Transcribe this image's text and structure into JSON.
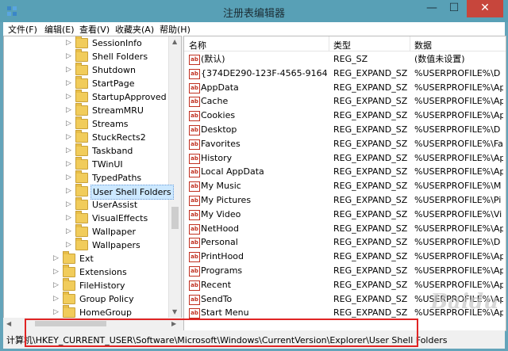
{
  "window": {
    "title": "注册表编辑器",
    "minimize": "—",
    "maximize": "☐",
    "close": "✕"
  },
  "menu": [
    "文件(F)",
    "编辑(E)",
    "查看(V)",
    "收藏夹(A)",
    "帮助(H)"
  ],
  "tree": [
    {
      "label": "SessionInfo",
      "level": 2
    },
    {
      "label": "Shell Folders",
      "level": 2
    },
    {
      "label": "Shutdown",
      "level": 2
    },
    {
      "label": "StartPage",
      "level": 2
    },
    {
      "label": "StartupApproved",
      "level": 2
    },
    {
      "label": "StreamMRU",
      "level": 2
    },
    {
      "label": "Streams",
      "level": 2
    },
    {
      "label": "StuckRects2",
      "level": 2
    },
    {
      "label": "Taskband",
      "level": 2
    },
    {
      "label": "TWinUI",
      "level": 2
    },
    {
      "label": "TypedPaths",
      "level": 2
    },
    {
      "label": "User Shell Folders",
      "level": 2,
      "selected": true
    },
    {
      "label": "UserAssist",
      "level": 2
    },
    {
      "label": "VisualEffects",
      "level": 2
    },
    {
      "label": "Wallpaper",
      "level": 2
    },
    {
      "label": "Wallpapers",
      "level": 2
    },
    {
      "label": "Ext",
      "level": 1
    },
    {
      "label": "Extensions",
      "level": 1
    },
    {
      "label": "FileHistory",
      "level": 1
    },
    {
      "label": "Group Policy",
      "level": 1
    },
    {
      "label": "HomeGroup",
      "level": 1
    }
  ],
  "list": {
    "columns": [
      "名称",
      "类型",
      "数据"
    ],
    "rows": [
      {
        "name": "(默认)",
        "type": "REG_SZ",
        "data": "(数值未设置)"
      },
      {
        "name": "{374DE290-123F-4565-9164-39...",
        "type": "REG_EXPAND_SZ",
        "data": "%USERPROFILE%\\D"
      },
      {
        "name": "AppData",
        "type": "REG_EXPAND_SZ",
        "data": "%USERPROFILE%\\Ap"
      },
      {
        "name": "Cache",
        "type": "REG_EXPAND_SZ",
        "data": "%USERPROFILE%\\Ap"
      },
      {
        "name": "Cookies",
        "type": "REG_EXPAND_SZ",
        "data": "%USERPROFILE%\\Ap"
      },
      {
        "name": "Desktop",
        "type": "REG_EXPAND_SZ",
        "data": "%USERPROFILE%\\D"
      },
      {
        "name": "Favorites",
        "type": "REG_EXPAND_SZ",
        "data": "%USERPROFILE%\\Fa"
      },
      {
        "name": "History",
        "type": "REG_EXPAND_SZ",
        "data": "%USERPROFILE%\\Ap"
      },
      {
        "name": "Local AppData",
        "type": "REG_EXPAND_SZ",
        "data": "%USERPROFILE%\\Ap"
      },
      {
        "name": "My Music",
        "type": "REG_EXPAND_SZ",
        "data": "%USERPROFILE%\\M"
      },
      {
        "name": "My Pictures",
        "type": "REG_EXPAND_SZ",
        "data": "%USERPROFILE%\\Pi"
      },
      {
        "name": "My Video",
        "type": "REG_EXPAND_SZ",
        "data": "%USERPROFILE%\\Vi"
      },
      {
        "name": "NetHood",
        "type": "REG_EXPAND_SZ",
        "data": "%USERPROFILE%\\Ap"
      },
      {
        "name": "Personal",
        "type": "REG_EXPAND_SZ",
        "data": "%USERPROFILE%\\D"
      },
      {
        "name": "PrintHood",
        "type": "REG_EXPAND_SZ",
        "data": "%USERPROFILE%\\Ap"
      },
      {
        "name": "Programs",
        "type": "REG_EXPAND_SZ",
        "data": "%USERPROFILE%\\Ap"
      },
      {
        "name": "Recent",
        "type": "REG_EXPAND_SZ",
        "data": "%USERPROFILE%\\Ap"
      },
      {
        "name": "SendTo",
        "type": "REG_EXPAND_SZ",
        "data": "%USERPROFILE%\\Ap"
      },
      {
        "name": "Start Menu",
        "type": "REG_EXPAND_SZ",
        "data": "%USERPROFILE%\\Ap"
      }
    ]
  },
  "status": {
    "path": "计算机\\HKEY_CURRENT_USER\\Software\\Microsoft\\Windows\\CurrentVersion\\Explorer\\User Shell Folders"
  },
  "icons": {
    "value": "ab",
    "expand": "▷",
    "scroll_up": "▲",
    "scroll_down": "▼",
    "scroll_left": "◀",
    "scroll_right": "▶"
  },
  "watermark": "Baidu"
}
